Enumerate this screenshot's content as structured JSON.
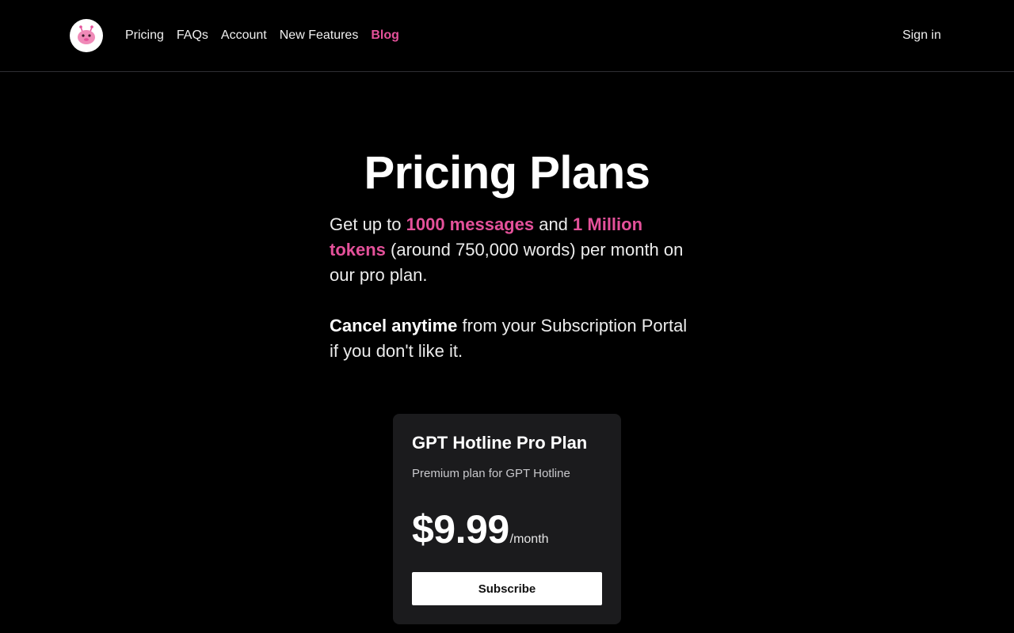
{
  "header": {
    "logo_icon": "robot-mascot-icon",
    "nav": [
      {
        "label": "Pricing",
        "active": false
      },
      {
        "label": "FAQs",
        "active": false
      },
      {
        "label": "Account",
        "active": false
      },
      {
        "label": "New Features",
        "active": false
      },
      {
        "label": "Blog",
        "active": true
      }
    ],
    "signin_label": "Sign in"
  },
  "hero": {
    "title": "Pricing Plans",
    "intro": {
      "part1": "Get up to ",
      "highlight1": "1000 messages",
      "part2": " and ",
      "highlight2": "1 Million tokens",
      "part3": " (around 750,000 words) per month on our pro plan."
    },
    "cancel": {
      "strong": "Cancel anytime",
      "rest": " from your Subscription Portal if you don't like it."
    }
  },
  "plan": {
    "name": "GPT Hotline Pro Plan",
    "description": "Premium plan for GPT Hotline",
    "price": "$9.99",
    "period": "/month",
    "button_label": "Subscribe"
  },
  "colors": {
    "accent": "#e4519a",
    "background": "#000000",
    "card": "#1b1b1d"
  }
}
